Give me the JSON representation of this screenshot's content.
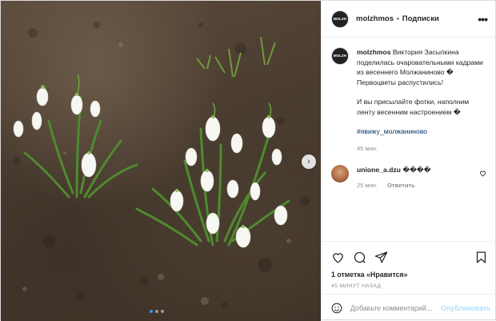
{
  "header": {
    "username": "molzhmos",
    "separator": "•",
    "follow_label": "Подписки",
    "more_icon": "more-horizontal-icon"
  },
  "avatar_text": "MOLZH",
  "caption": {
    "username": "molzhmos",
    "text_1": "Виктория Засыпкина поделилась очаровательными кадрами из весеннего Молжаниново � Первоцветы распустились!",
    "text_2": "И вы присылайте фотки, наполним ленту весенним настроением �",
    "hashtag": "#явижу_молжаниново",
    "time": "45 мин."
  },
  "comment": {
    "username": "unione_a.dzu",
    "text": "����",
    "time": "25 мин.",
    "reply_label": "Ответить"
  },
  "likes": {
    "count": "1 отметка",
    "label": "«Нравится»"
  },
  "timestamp": "45 МИНУТ НАЗАД",
  "add_comment": {
    "placeholder": "Добавьте комментарий...",
    "publish_label": "Опубликовать"
  },
  "carousel": {
    "next_label": "›",
    "slides": 3,
    "active": 1
  },
  "colors": {
    "link": "#003569",
    "accent": "#3897f0",
    "publish_disabled": "#b2dffc",
    "meta": "#8e8e8e"
  }
}
